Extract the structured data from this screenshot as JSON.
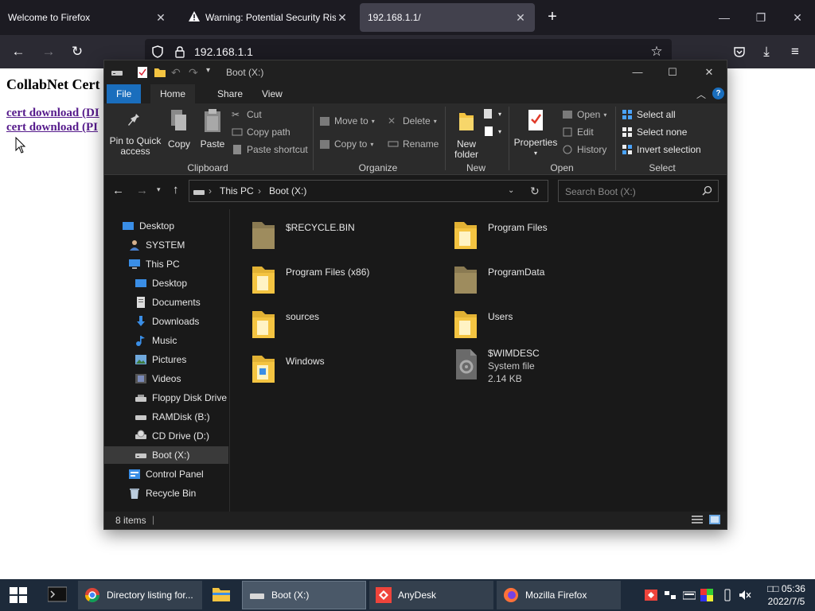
{
  "browser": {
    "tabs": [
      {
        "title": "Welcome to Firefox"
      },
      {
        "title": "Warning: Potential Security Risk Ahead"
      },
      {
        "title": "192.168.1.1/"
      }
    ],
    "url": "192.168.1.1"
  },
  "page": {
    "heading": "CollabNet Cert",
    "links": [
      "cert download (DI",
      "cert download (PI"
    ]
  },
  "explorer": {
    "title": "Boot (X:)",
    "ribbon_tabs": [
      "File",
      "Home",
      "Share",
      "View"
    ],
    "clipboard": {
      "pin_label": "Pin to Quick access",
      "copy_label": "Copy",
      "paste_label": "Paste",
      "cut_label": "Cut",
      "copy_path_label": "Copy path",
      "paste_shortcut_label": "Paste shortcut",
      "group_label": "Clipboard"
    },
    "organize": {
      "move_to_label": "Move to",
      "copy_to_label": "Copy to",
      "delete_label": "Delete",
      "rename_label": "Rename",
      "group_label": "Organize"
    },
    "new": {
      "new_folder_label": "New folder",
      "group_label": "New"
    },
    "open": {
      "properties_label": "Properties",
      "open_label": "Open",
      "edit_label": "Edit",
      "history_label": "History",
      "group_label": "Open"
    },
    "select": {
      "select_all_label": "Select all",
      "select_none_label": "Select none",
      "invert_label": "Invert selection",
      "group_label": "Select"
    },
    "address": {
      "crumbs": [
        "This PC",
        "Boot (X:)"
      ]
    },
    "search_placeholder": "Search Boot (X:)",
    "nav_items": [
      {
        "label": "Desktop",
        "icon": "desktop-icon"
      },
      {
        "label": "SYSTEM",
        "icon": "user-icon"
      },
      {
        "label": "This PC",
        "icon": "computer-icon"
      },
      {
        "label": "Desktop",
        "icon": "desktop-icon"
      },
      {
        "label": "Documents",
        "icon": "documents-icon"
      },
      {
        "label": "Downloads",
        "icon": "downloads-icon"
      },
      {
        "label": "Music",
        "icon": "music-icon"
      },
      {
        "label": "Pictures",
        "icon": "pictures-icon"
      },
      {
        "label": "Videos",
        "icon": "videos-icon"
      },
      {
        "label": "Floppy Disk Drive",
        "icon": "floppy-icon"
      },
      {
        "label": "RAMDisk (B:)",
        "icon": "drive-icon"
      },
      {
        "label": "CD Drive (D:)",
        "icon": "cd-drive-icon"
      },
      {
        "label": "Boot (X:)",
        "icon": "drive-icon"
      },
      {
        "label": "Control Panel",
        "icon": "control-panel-icon"
      },
      {
        "label": "Recycle Bin",
        "icon": "recycle-bin-icon"
      }
    ],
    "files": [
      {
        "name": "$RECYCLE.BIN",
        "icon": "folder-icon"
      },
      {
        "name": "Program Files",
        "icon": "folder-icon"
      },
      {
        "name": "Program Files (x86)",
        "icon": "folder-icon"
      },
      {
        "name": "ProgramData",
        "icon": "folder-icon"
      },
      {
        "name": "sources",
        "icon": "folder-icon"
      },
      {
        "name": "Users",
        "icon": "folder-icon"
      },
      {
        "name": "Windows",
        "icon": "folder-icon"
      },
      {
        "name": "$WIMDESC",
        "type": "System file",
        "size": "2.14 KB",
        "icon": "system-file-icon"
      }
    ],
    "status": {
      "item_count": "8 items"
    }
  },
  "taskbar": {
    "items": [
      {
        "label": "Directory listing for...",
        "icon": "chrome-icon"
      },
      {
        "label": "Boot (X:)",
        "icon": "drive-icon"
      },
      {
        "label": "AnyDesk",
        "icon": "anydesk-icon"
      },
      {
        "label": "Mozilla Firefox",
        "icon": "firefox-icon"
      }
    ],
    "clock_time": "□□ 05:36",
    "clock_date": "2022/7/5"
  },
  "colors": {
    "firefox_tabbar": "#1c1b22",
    "explorer_bg": "#191919",
    "file_tab": "#1a6ebd",
    "folder_yellow": "#f4c441",
    "taskbar": "#1d2a3a"
  }
}
